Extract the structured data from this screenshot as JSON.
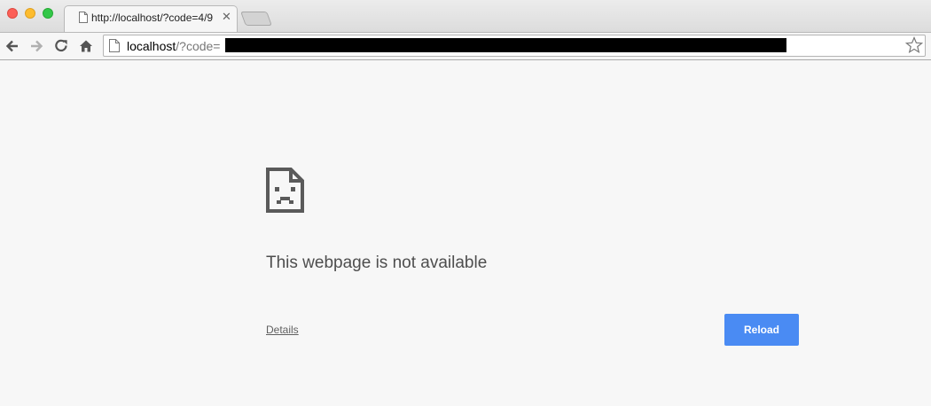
{
  "window": {
    "tab": {
      "title": "http://localhost/?code=4/9",
      "close_glyph": "✕"
    }
  },
  "toolbar": {
    "back_icon": "back-arrow-icon",
    "forward_icon": "forward-arrow-icon",
    "reload_icon": "reload-icon",
    "home_icon": "home-icon",
    "address": {
      "host": "localhost",
      "path": "/?code="
    },
    "bookmark_icon": "star-icon"
  },
  "error_page": {
    "icon": "sad-page-icon",
    "title": "This webpage is not available",
    "details_label": "Details",
    "reload_label": "Reload",
    "accent": "#4a8bf3"
  }
}
